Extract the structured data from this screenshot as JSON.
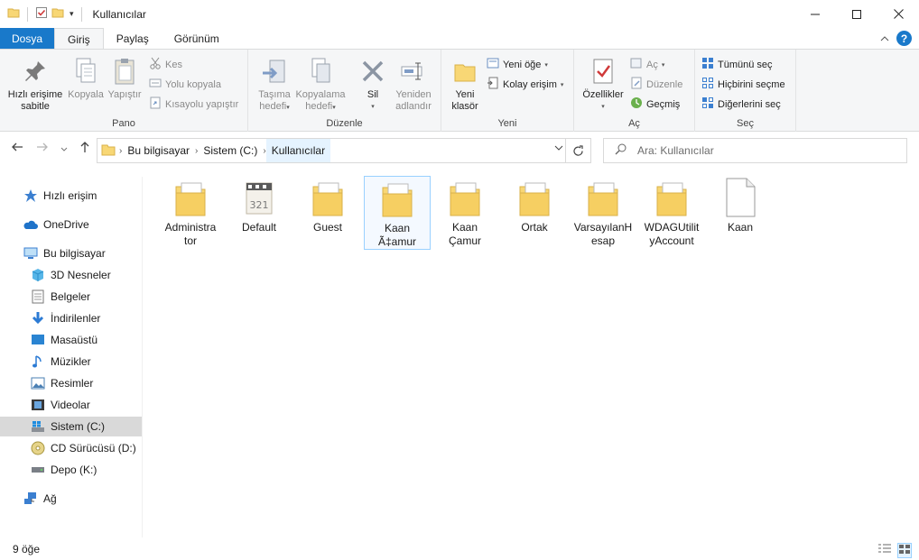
{
  "window": {
    "title": "Kullanıcılar"
  },
  "tabs": {
    "file": "Dosya",
    "home": "Giriş",
    "share": "Paylaş",
    "view": "Görünüm"
  },
  "ribbon": {
    "pano": {
      "label": "Pano",
      "pin": "Hızlı erişime\nsabitle",
      "copy": "Kopyala",
      "paste": "Yapıştır",
      "cut": "Kes",
      "copy_path": "Yolu kopyala",
      "paste_shortcut": "Kısayolu yapıştır"
    },
    "duzenle": {
      "label": "Düzenle",
      "move_to": "Taşıma\nhedefi",
      "copy_to": "Kopyalama\nhedefi",
      "delete": "Sil",
      "rename": "Yeniden\nadlandır"
    },
    "yeni": {
      "label": "Yeni",
      "new_folder": "Yeni\nklasör",
      "new_item": "Yeni öğe",
      "easy_access": "Kolay erişim"
    },
    "ac": {
      "label": "Aç",
      "properties": "Özellikler",
      "open": "Aç",
      "edit": "Düzenle",
      "history": "Geçmiş"
    },
    "sec": {
      "label": "Seç",
      "select_all": "Tümünü seç",
      "select_none": "Hiçbirini seçme",
      "invert": "Diğerlerini seç"
    }
  },
  "address": {
    "crumbs": [
      "Bu bilgisayar",
      "Sistem (C:)",
      "Kullanıcılar"
    ],
    "search_placeholder": "Ara: Kullanıcılar"
  },
  "navpane": {
    "quick_access": "Hızlı erişim",
    "onedrive": "OneDrive",
    "this_pc": "Bu bilgisayar",
    "items": [
      "3D Nesneler",
      "Belgeler",
      "İndirilenler",
      "Masaüstü",
      "Müzikler",
      "Resimler",
      "Videolar",
      "Sistem (C:)",
      "CD Sürücüsü (D:)",
      "Depo (K:)"
    ],
    "network": "Ağ"
  },
  "files": [
    {
      "name": "Administra\ntor",
      "type": "folder"
    },
    {
      "name": "Default",
      "type": "default"
    },
    {
      "name": "Guest",
      "type": "folder"
    },
    {
      "name": "Kaan\nÃ‡amur",
      "type": "folder"
    },
    {
      "name": "Kaan\nÇamur",
      "type": "folder"
    },
    {
      "name": "Ortak",
      "type": "folder"
    },
    {
      "name": "VarsayılanH\nesap",
      "type": "folder"
    },
    {
      "name": "WDAGUtilit\nyAccount",
      "type": "folder"
    },
    {
      "name": "Kaan",
      "type": "file"
    }
  ],
  "status": {
    "count": "9 öğe"
  },
  "colors": {
    "accent": "#1979ca",
    "folder": "#f8d775",
    "selection": "#cce8ff"
  }
}
